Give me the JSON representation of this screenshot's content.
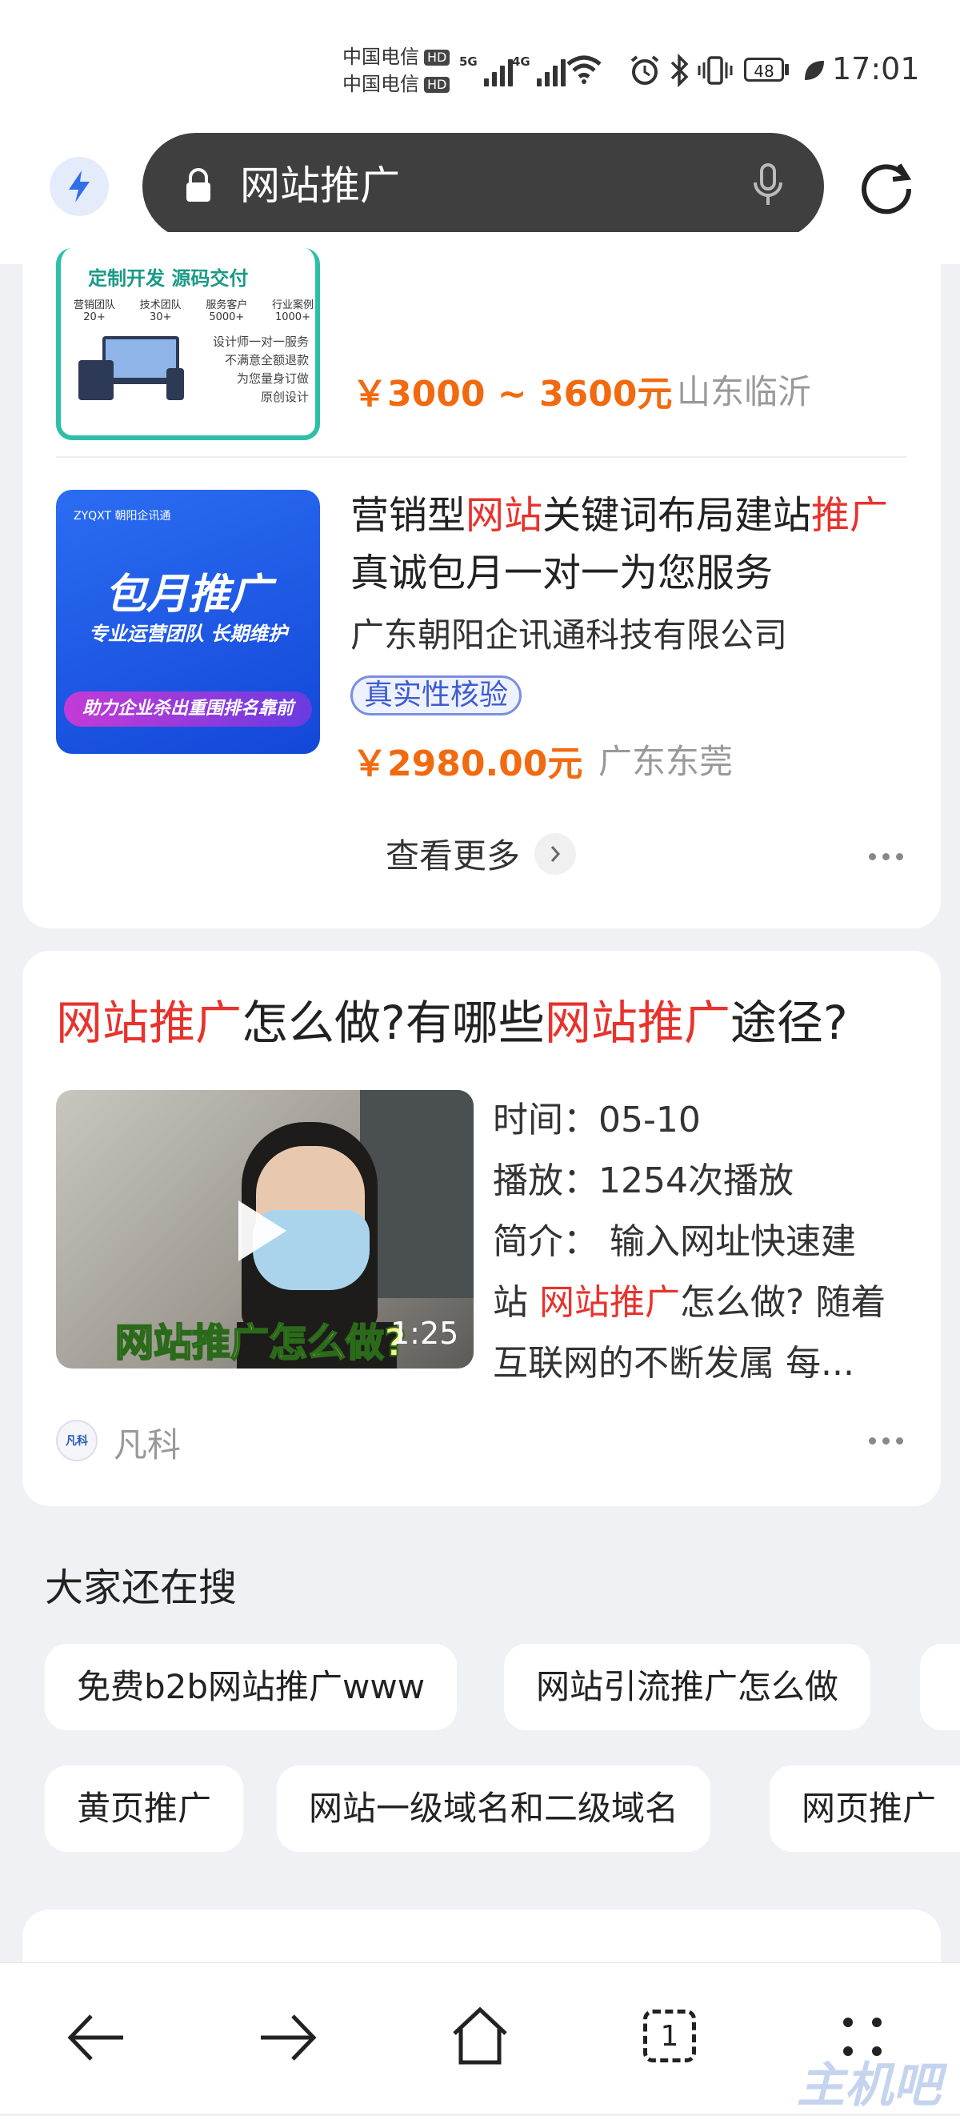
{
  "status_bar": {
    "carrier1": "中国电信",
    "carrier2": "中国电信",
    "hd": "HD",
    "net1": "5G",
    "net2": "4G",
    "battery": "48",
    "time": "17:01"
  },
  "search": {
    "query": "网站推广",
    "icons": [
      "bolt-icon",
      "lock-icon",
      "mic-icon",
      "refresh-icon"
    ]
  },
  "product1": {
    "image_texts": {
      "heading": "定制开发 源码交付",
      "stats": [
        {
          "label": "营销团队",
          "value": "20+"
        },
        {
          "label": "技术团队",
          "value": "30+"
        },
        {
          "label": "服务客户",
          "value": "5000+"
        },
        {
          "label": "行业案例",
          "value": "1000+"
        }
      ],
      "bullets": [
        "设计师一对一服务",
        "不满意全额退款",
        "为您量身订做",
        "原创设计"
      ]
    },
    "price": "￥3000 ~ 3600元",
    "location": "山东临沂"
  },
  "product2": {
    "image_texts": {
      "brand": "ZYQXT 朝阳企讯通",
      "big": "包月推广",
      "sub": "专业运营团队 长期维护",
      "banner": "助力企业杀出重围排名靠前"
    },
    "title_parts": [
      "营销型",
      "网站",
      "关键词布局建站",
      "推广",
      " 真诚包月一对一为您服务"
    ],
    "company": "广东朝阳企讯通科技有限公司",
    "tag": "真实性核验",
    "price": "￥2980.00元",
    "location": "广东东莞"
  },
  "see_more": "查看更多",
  "video_card": {
    "title_parts": [
      "网站推广",
      "怎么做?有哪些",
      "网站推广",
      "途径?"
    ],
    "time": "时间：05-10",
    "plays": "播放：1254次播放",
    "intro_lines": [
      [
        "简介：  输入网址快速建"
      ],
      [
        "站 ",
        "网站推广",
        "怎么做? 随着"
      ],
      [
        "互联网的不断发属 每..."
      ]
    ],
    "thumb_caption": "网站推广怎么做?",
    "duration": "1:25",
    "source": "凡科",
    "source_logo_text": "凡科"
  },
  "related": {
    "heading": "大家还在搜",
    "row1": [
      "免费b2b网站推广www",
      "网站引流推广怎么做"
    ],
    "row2": [
      "黄页推广",
      "网站一级域名和二级域名",
      "网页推广"
    ]
  },
  "nav": {
    "tabs_count": "1",
    "icons": [
      "back-arrow-icon",
      "forward-arrow-icon",
      "home-icon",
      "tabs-icon",
      "menu-icon"
    ]
  },
  "watermark": "主机吧",
  "colors": {
    "highlight": "#e8322c",
    "price": "#f26a10",
    "tag_blue": "#3f5bd0"
  }
}
